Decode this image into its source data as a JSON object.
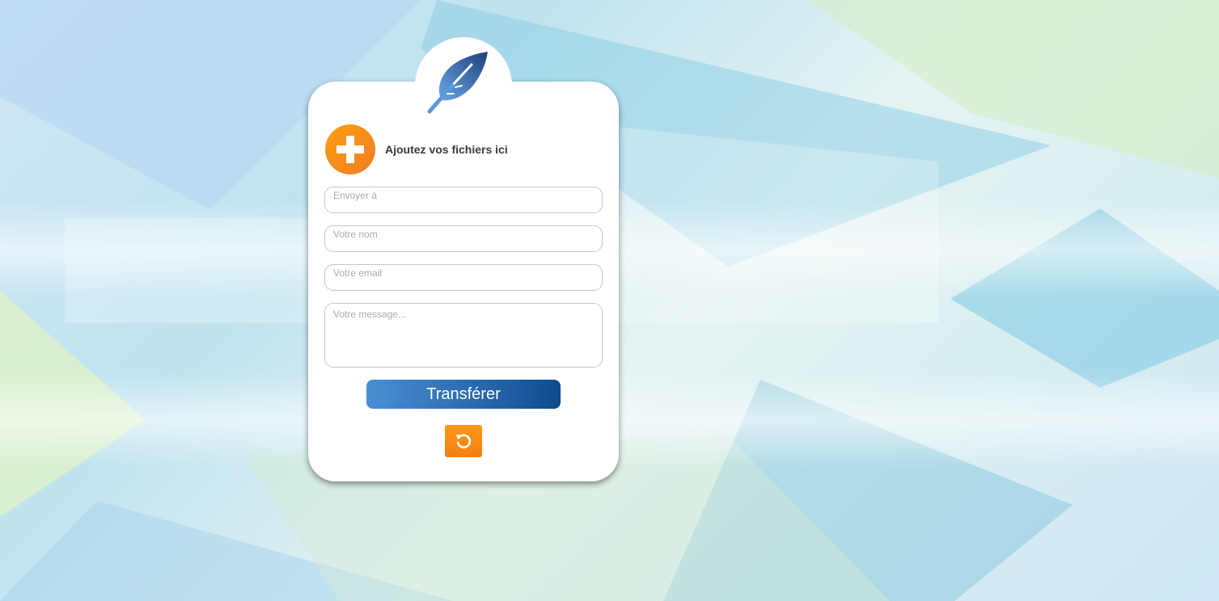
{
  "upload": {
    "add_label": "Ajoutez vos fichiers ici",
    "add_icon": "plus-circle-icon"
  },
  "form": {
    "recipient_placeholder": "Envoyer à",
    "name_placeholder": "Votre nom",
    "email_placeholder": "Votre email",
    "message_placeholder": "Votre message..."
  },
  "actions": {
    "submit_label": "Transférer",
    "reset_icon": "undo-icon"
  },
  "brand": {
    "logo_icon": "feather-icon",
    "accent_orange": "#f7921e",
    "accent_blue": "#1f5ea3"
  }
}
